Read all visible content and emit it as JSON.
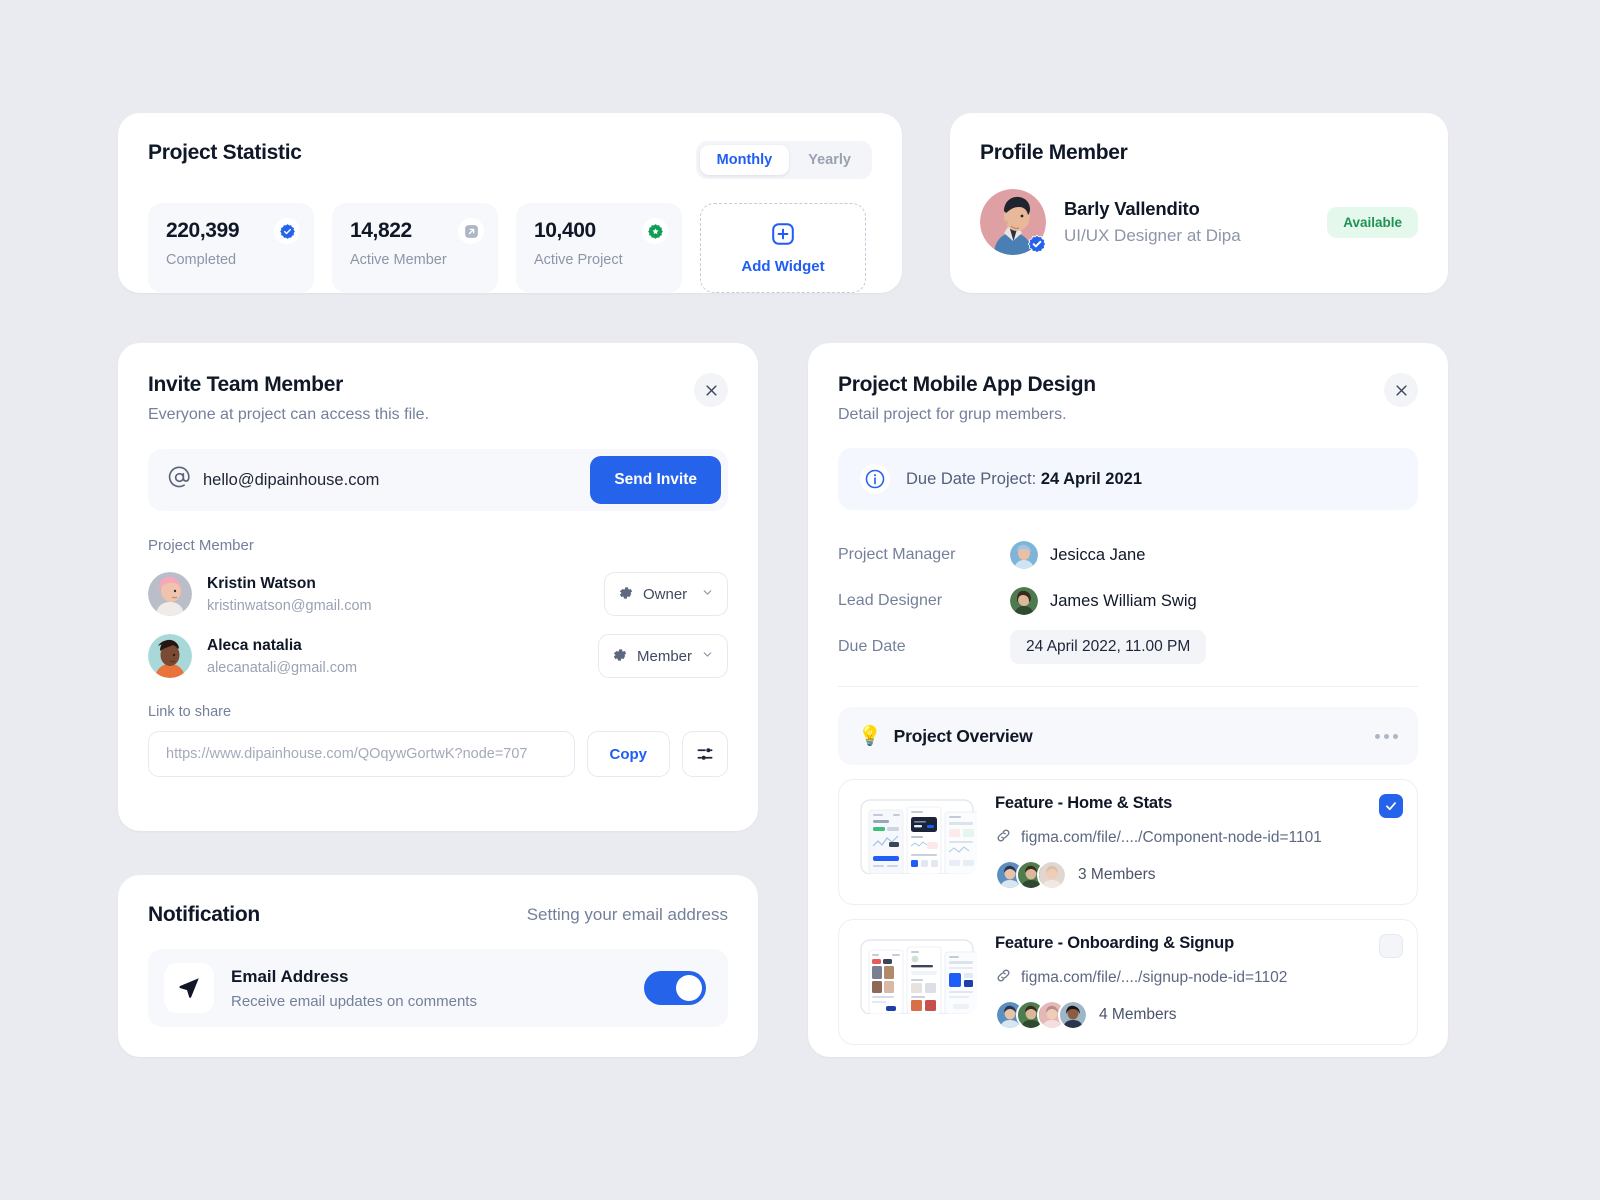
{
  "theme": {
    "background": "#eaebf0",
    "card": "#ffffff",
    "accent": "#2563eb",
    "accent_text": "#1f5df6",
    "muted_text": "#74809a",
    "success_bg": "#e4f8ec",
    "success_text": "#1f9254"
  },
  "statistic": {
    "title": "Project Statistic",
    "range_tabs": [
      {
        "label": "Monthly",
        "active": true
      },
      {
        "label": "Yearly",
        "active": false
      }
    ],
    "stats": [
      {
        "value": "220,399",
        "label": "Completed",
        "icon": "verified-badge-icon",
        "icon_color": "#2563eb"
      },
      {
        "value": "14,822",
        "label": "Active Member",
        "icon": "arrow-up-right-badge-icon",
        "icon_color": "#9aa2b4"
      },
      {
        "value": "10,400",
        "label": "Active Project",
        "icon": "star-badge-icon",
        "icon_color": "#0f9d58"
      }
    ],
    "add_widget": {
      "label": "Add Widget",
      "icon": "plus-square-icon"
    }
  },
  "profile": {
    "title": "Profile Member",
    "name": "Barly Vallendito",
    "role": "UI/UX Designer at Dipa",
    "status": "Available",
    "verified": true
  },
  "invite": {
    "title": "Invite Team Member",
    "subtitle": "Everyone at project can access this file.",
    "close_label": "×",
    "email_value": "hello@dipainhouse.com",
    "email_icon": "at-sign-icon",
    "send_label": "Send Invite",
    "members_label": "Project Member",
    "members": [
      {
        "name": "Kristin Watson",
        "email": "kristinwatson@gmail.com",
        "role": "Owner"
      },
      {
        "name": "Aleca natalia",
        "email": "alecanatali@gmail.com",
        "role": "Member"
      }
    ],
    "link_label": "Link to share",
    "link_placeholder": "https://www.dipainhouse.com/QOqywGortwK?node=707",
    "copy_label": "Copy",
    "settings_icon": "sliders-icon"
  },
  "notification": {
    "title": "Notification",
    "right_text": "Setting your email address",
    "item_title": "Email Address",
    "item_subtitle": "Receive email updates on comments",
    "item_icon": "send-icon",
    "enabled": true
  },
  "project": {
    "title": "Project Mobile App Design",
    "subtitle": "Detail project for grup members.",
    "close_label": "×",
    "info_icon": "info-circle-icon",
    "info_prefix": "Due Date Project: ",
    "info_date": "24 April 2021",
    "meta": [
      {
        "key": "Project Manager",
        "value": "Jesicca Jane",
        "type": "person"
      },
      {
        "key": "Lead Designer",
        "value": "James William Swig",
        "type": "person"
      },
      {
        "key": "Due Date",
        "value": "24 April 2022, 11.00 PM",
        "type": "chip"
      }
    ],
    "overview": {
      "icon": "lightbulb-icon",
      "title": "Project Overview",
      "menu_icon": "more-horizontal-icon"
    },
    "features": [
      {
        "title": "Feature - Home & Stats",
        "link": "figma.com/file/..../Component-node-id=1101",
        "link_icon": "link-icon",
        "members_count": "3 Members",
        "avatars": 3,
        "checked": true,
        "thumb": "dashboard-screens"
      },
      {
        "title": "Feature - Onboarding & Signup",
        "link": "figma.com/file/..../signup-node-id=1102",
        "link_icon": "link-icon",
        "members_count": "4 Members",
        "avatars": 4,
        "checked": false,
        "thumb": "gallery-screens"
      }
    ]
  }
}
